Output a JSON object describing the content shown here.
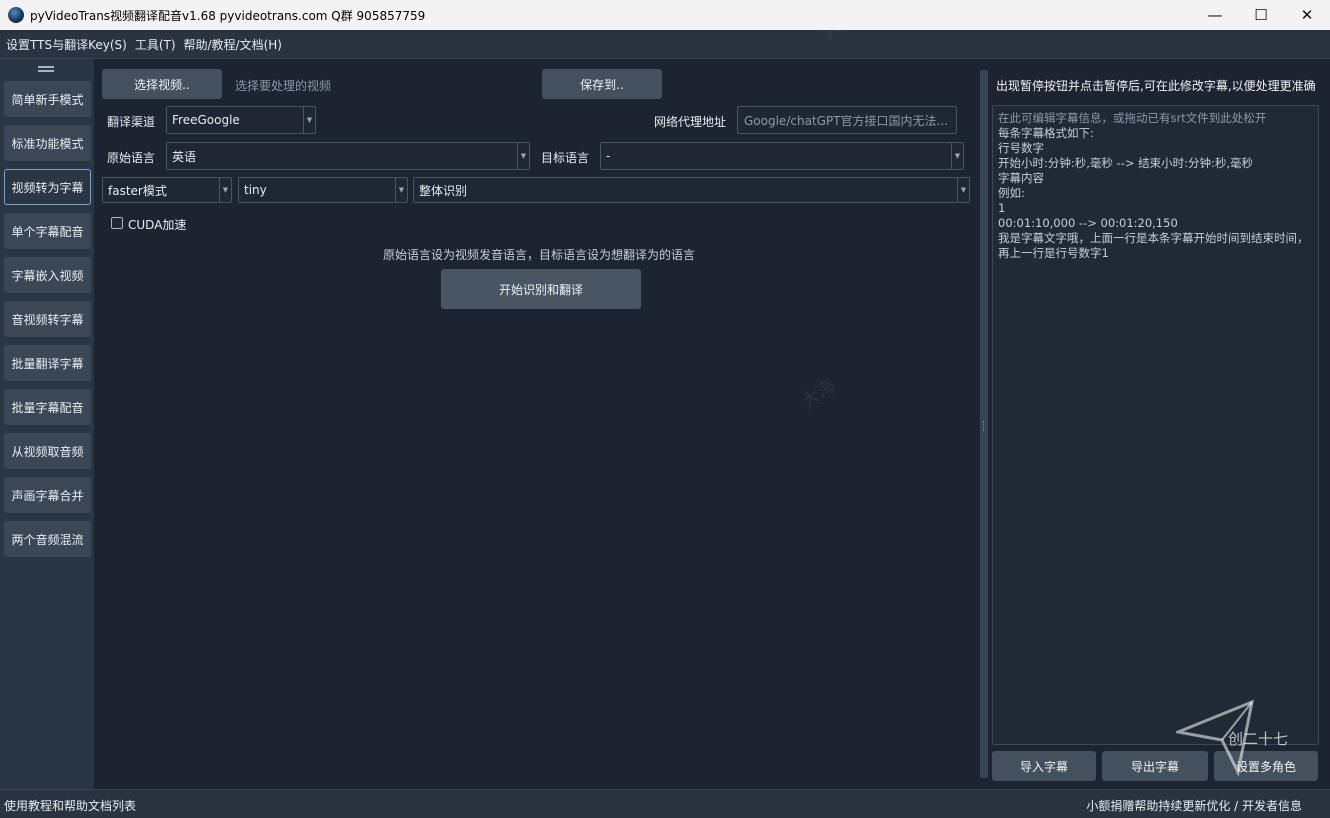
{
  "window": {
    "title": "pyVideoTrans视频翻译配音v1.68 pyvideotrans.com  Q群 905857759",
    "minimize": "—",
    "maximize": "☐",
    "close": "✕"
  },
  "menu": [
    "设置TTS与翻译Key(S)",
    "工具(T)",
    "帮助/教程/文档(H)"
  ],
  "sidebar": {
    "items": [
      {
        "label": "简单新手模式",
        "active": false
      },
      {
        "label": "标准功能模式",
        "active": false
      },
      {
        "label": "视频转为字幕",
        "active": true
      },
      {
        "label": "单个字幕配音",
        "active": false
      },
      {
        "label": "字幕嵌入视频",
        "active": false
      },
      {
        "label": "音视频转字幕",
        "active": false
      },
      {
        "label": "批量翻译字幕",
        "active": false
      },
      {
        "label": "批量字幕配音",
        "active": false
      },
      {
        "label": "从视频取音频",
        "active": false
      },
      {
        "label": "声画字幕合并",
        "active": false
      },
      {
        "label": "两个音频混流",
        "active": false
      }
    ]
  },
  "main": {
    "select_video_button": "选择视频..",
    "select_video_hint": "选择要处理的视频",
    "save_to_button": "保存到..",
    "translate_channel_label": "翻译渠道",
    "translate_channel_value": "FreeGoogle",
    "proxy_label": "网络代理地址",
    "proxy_placeholder": "Google/chatGPT官方接口国内无法...",
    "source_lang_label": "原始语言",
    "source_lang_value": "英语",
    "target_lang_label": "目标语言",
    "target_lang_value": "-",
    "mode_value": "faster模式",
    "model_value": "tiny",
    "recognition_value": "整体识别",
    "cuda_label": "CUDA加速",
    "cuda_checked": false,
    "tip_text": "原始语言设为视频发音语言，目标语言设为想翻译为的语言",
    "start_button": "开始识别和翻译"
  },
  "right_panel": {
    "title": "出现暂停按钮并点击暂停后,可在此修改字幕,以便处理更准确",
    "editor_placeholder": "在此可编辑字幕信息，或拖动已有srt文件到此处松开",
    "editor_lines": [
      "",
      "每条字幕格式如下:",
      "",
      "行号数字",
      "开始小时:分钟:秒,毫秒 --> 结束小时:分钟:秒,毫秒",
      "字幕内容",
      "",
      "例如:",
      "",
      "1",
      "00:01:10,000 --> 00:01:20,150",
      "我是字幕文字哦，上面一行是本条字幕开始时间到结束时间，再上一行是行号数字1"
    ],
    "import_button": "导入字幕",
    "export_button": "导出字幕",
    "roles_button": "设置多角色"
  },
  "status": {
    "left": "使用教程和帮助文档列表",
    "right": "小额捐赠帮助持续更新优化 / 开发者信息"
  },
  "logo_text": "创二十七",
  "watermark_text": "大海"
}
